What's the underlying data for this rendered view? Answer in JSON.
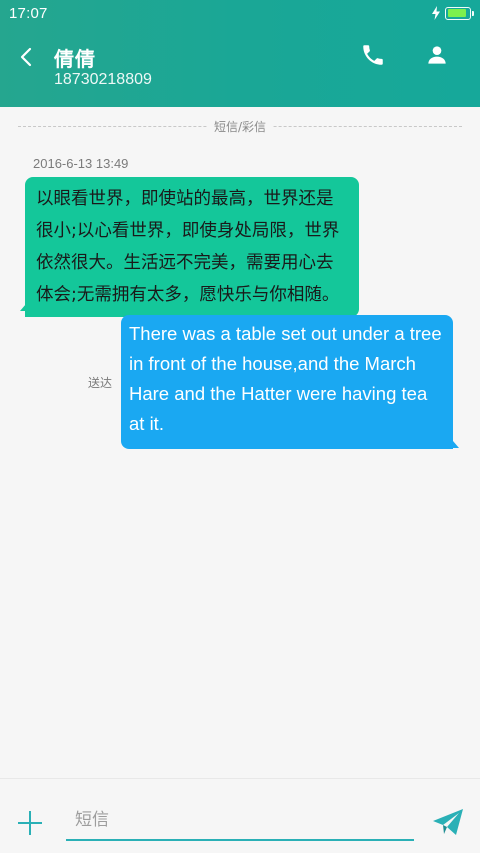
{
  "status_bar": {
    "time": "17:07",
    "battery_level": 0.9,
    "charging_icon": "bolt-icon",
    "battery_icon": "battery-icon",
    "battery_color": "#7cf04e"
  },
  "header": {
    "back_icon": "chevron-left-icon",
    "contact_name": "倩倩",
    "contact_number": "18730218809",
    "call_icon": "phone-icon",
    "profile_icon": "person-icon",
    "background_color": "#1ea894"
  },
  "conversation": {
    "channel_label": "短信/彩信",
    "messages": [
      {
        "direction": "incoming",
        "timestamp": "2016-6-13 13:49",
        "text": "以眼看世界，即使站的最高，世界还是很小;以心看世界，即使身处局限，世界依然很大。生活远不完美，需要用心去体会;无需拥有太多，愿快乐与你相随。",
        "bubble_color": "#14c79a"
      },
      {
        "direction": "outgoing",
        "status": "送达",
        "text": "There was a table set out under a tree in front of the house,and the March Hare and the Hatter were having tea at it.",
        "bubble_color": "#1aa8f2"
      }
    ]
  },
  "composer": {
    "add_icon": "plus-icon",
    "placeholder": "短信",
    "value": "",
    "send_icon": "send-icon",
    "accent_color": "#2ab0b6"
  }
}
